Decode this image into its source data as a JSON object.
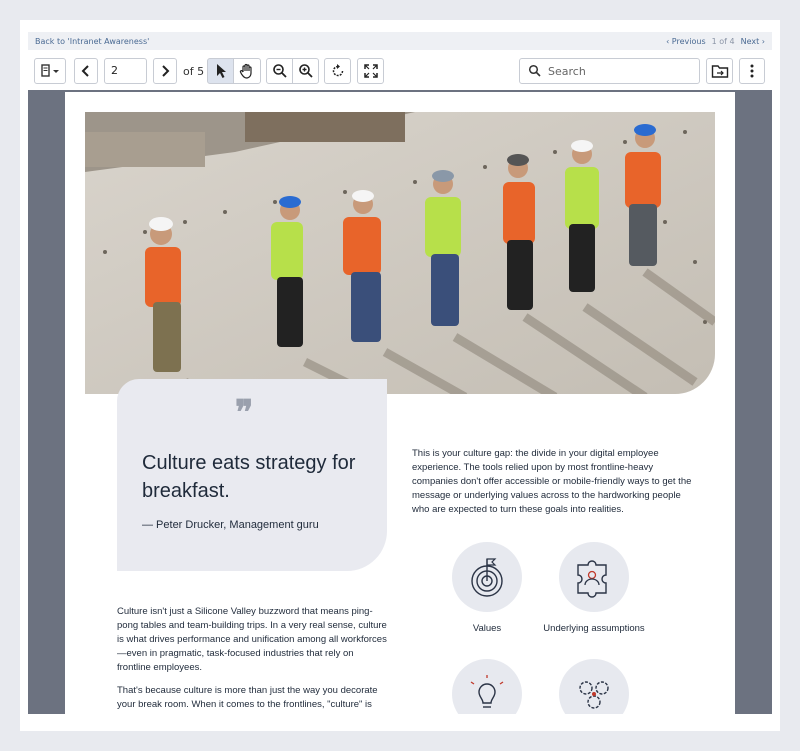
{
  "nav": {
    "back_label": "Back to 'Intranet Awareness'",
    "prev_label": "‹ Previous",
    "position": "1 of 4",
    "next_label": "Next ›"
  },
  "toolbar": {
    "page_value": "2",
    "page_total_label": "of 5",
    "search_placeholder": "Search"
  },
  "document": {
    "quote": {
      "text": "Culture eats strategy for breakfast.",
      "attribution": "— Peter Drucker, Management guru"
    },
    "culture_gap_paragraph": "This is your culture gap: the divide in your digital employee experience. The tools relied upon by most frontline-heavy companies don't offer accessible or mobile-friendly ways to get the message or underlying values across to the hardworking people who are expected to turn these goals into realities.",
    "icons": [
      {
        "label": "Values",
        "icon": "target-icon"
      },
      {
        "label": "Underlying assumptions",
        "icon": "puzzle-person-icon"
      },
      {
        "label": "",
        "icon": "lightbulb-icon"
      },
      {
        "label": "",
        "icon": "gears-people-icon"
      }
    ],
    "body_paragraph_1": "Culture isn't just a Silicone Valley buzzword that means ping-pong tables and team-building trips. In a very real sense, culture is what drives performance and unification among all workforces—even in pragmatic, task-focused industries that rely on frontline employees.",
    "body_paragraph_2": "That's because culture is more than just the way you decorate your break room. When it comes to the frontlines, \"culture\" is"
  },
  "colors": {
    "viewer_bg": "#6c7280",
    "link": "#4a6a93",
    "card_bg": "#e9eaf0",
    "text": "#1f2a3a"
  }
}
